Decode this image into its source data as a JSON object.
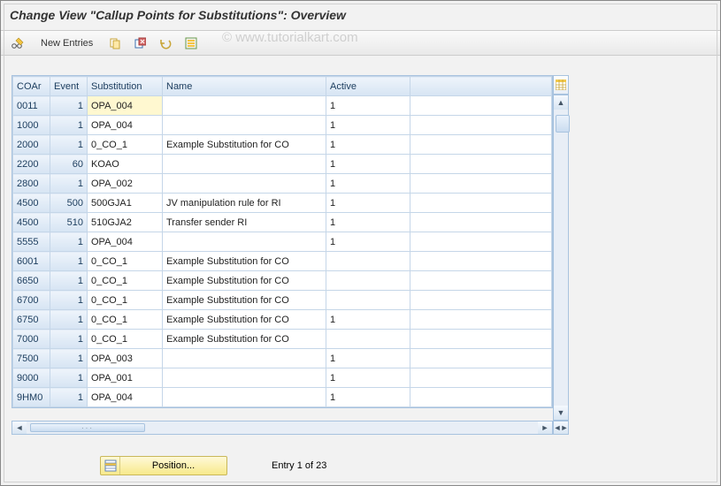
{
  "title": "Change View \"Callup Points for Substitutions\": Overview",
  "watermark": "©   www.tutorialkart.com",
  "toolbar": {
    "new_entries_label": "New Entries"
  },
  "columns": {
    "coar": "COAr",
    "event": "Event",
    "substitution": "Substitution",
    "name": "Name",
    "active": "Active"
  },
  "rows": [
    {
      "coar": "0011",
      "event": "1",
      "subst": "OPA_004",
      "name": "",
      "active": "1",
      "hl": true
    },
    {
      "coar": "1000",
      "event": "1",
      "subst": "OPA_004",
      "name": "",
      "active": "1"
    },
    {
      "coar": "2000",
      "event": "1",
      "subst": "0_CO_1",
      "name": "Example Substitution for CO",
      "active": "1"
    },
    {
      "coar": "2200",
      "event": "60",
      "subst": "KOAO",
      "name": "",
      "active": "1"
    },
    {
      "coar": "2800",
      "event": "1",
      "subst": "OPA_002",
      "name": "",
      "active": "1"
    },
    {
      "coar": "4500",
      "event": "500",
      "subst": "500GJA1",
      "name": "JV manipulation rule for RI",
      "active": "1"
    },
    {
      "coar": "4500",
      "event": "510",
      "subst": "510GJA2",
      "name": "Transfer sender RI",
      "active": "1"
    },
    {
      "coar": "5555",
      "event": "1",
      "subst": "OPA_004",
      "name": "",
      "active": "1"
    },
    {
      "coar": "6001",
      "event": "1",
      "subst": "0_CO_1",
      "name": "Example Substitution for CO",
      "active": ""
    },
    {
      "coar": "6650",
      "event": "1",
      "subst": "0_CO_1",
      "name": "Example Substitution for CO",
      "active": ""
    },
    {
      "coar": "6700",
      "event": "1",
      "subst": "0_CO_1",
      "name": "Example Substitution for CO",
      "active": ""
    },
    {
      "coar": "6750",
      "event": "1",
      "subst": "0_CO_1",
      "name": "Example Substitution for CO",
      "active": "1"
    },
    {
      "coar": "7000",
      "event": "1",
      "subst": "0_CO_1",
      "name": "Example Substitution for CO",
      "active": ""
    },
    {
      "coar": "7500",
      "event": "1",
      "subst": "OPA_003",
      "name": "",
      "active": "1"
    },
    {
      "coar": "9000",
      "event": "1",
      "subst": "OPA_001",
      "name": "",
      "active": "1"
    },
    {
      "coar": "9HM0",
      "event": "1",
      "subst": "OPA_004",
      "name": "",
      "active": "1"
    }
  ],
  "footer": {
    "position_label": "Position...",
    "entry_text": "Entry 1 of 23"
  }
}
